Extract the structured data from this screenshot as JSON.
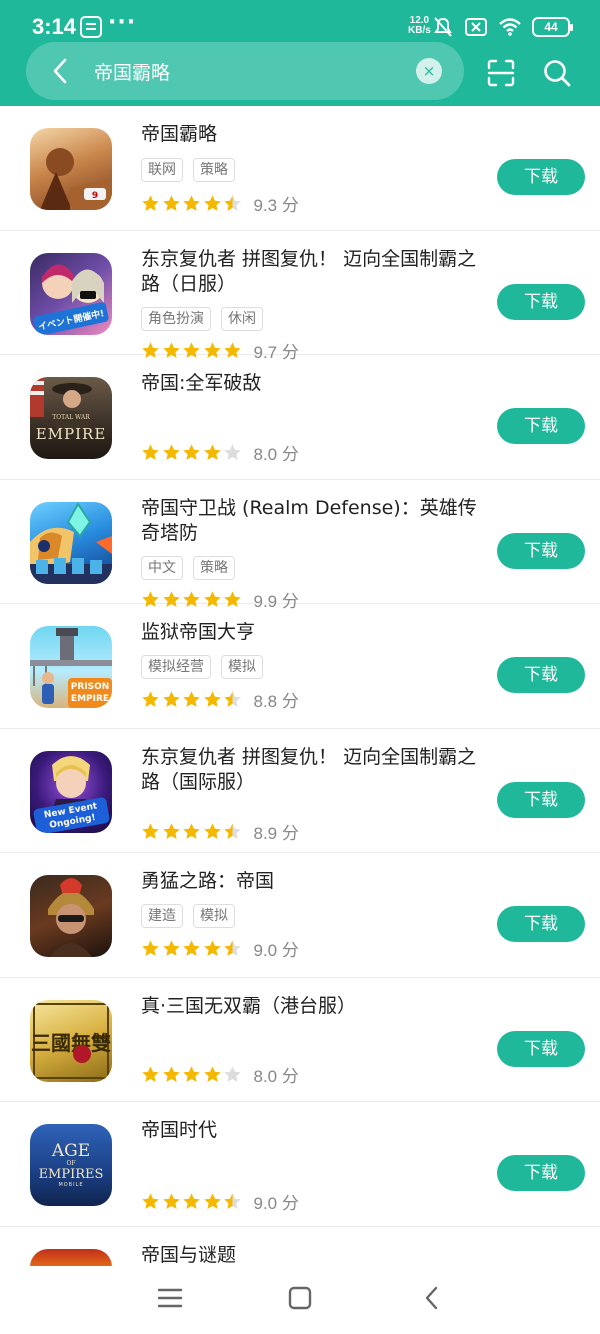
{
  "status_bar": {
    "time": "3:14",
    "dots": "···",
    "speed_value": "12.0",
    "speed_unit": "KB/s",
    "battery": "44"
  },
  "search": {
    "query": "帝国霸略",
    "clear_label": "×"
  },
  "download_label": "下载",
  "score_unit": "分",
  "items": [
    {
      "title": "帝国霸略",
      "tags": [
        "联网",
        "策略"
      ],
      "score": "9.3",
      "stars": 4.5
    },
    {
      "title": "东京复仇者 拼图复仇！ 迈向全国制霸之路（日服）",
      "tags": [
        "角色扮演",
        "休闲"
      ],
      "score": "9.7",
      "stars": 5
    },
    {
      "title": "帝国:全军破敌",
      "tags": [],
      "score": "8.0",
      "stars": 4
    },
    {
      "title": "帝国守卫战 (Realm Defense)：英雄传奇塔防",
      "tags": [
        "中文",
        "策略"
      ],
      "score": "9.9",
      "stars": 5
    },
    {
      "title": "监狱帝国大亨",
      "tags": [
        "模拟经营",
        "模拟"
      ],
      "score": "8.8",
      "stars": 4.5
    },
    {
      "title": "东京复仇者 拼图复仇！ 迈向全国制霸之路（国际服）",
      "tags": [],
      "score": "8.9",
      "stars": 4.5
    },
    {
      "title": "勇猛之路：帝国",
      "tags": [
        "建造",
        "模拟"
      ],
      "score": "9.0",
      "stars": 4.5
    },
    {
      "title": "真·三国无双霸（港台服）",
      "tags": [],
      "score": "8.0",
      "stars": 4
    },
    {
      "title": "帝国时代",
      "tags": [],
      "score": "9.0",
      "stars": 4.5
    },
    {
      "title": "帝国与谜题",
      "tags": [],
      "score": "",
      "stars": 0
    }
  ],
  "icon_texts": {
    "item2": "イベント開催中!",
    "item3_top": "TOTAL WAR",
    "item3_main": "EMPIRE",
    "item5_top": "PRISON",
    "item5_main": "EMPIRE",
    "item6_a": "New Event",
    "item6_b": "Ongoing!",
    "item8": "三國無雙",
    "item9_a": "AGE",
    "item9_b": "OF",
    "item9_c": "EMPIRES",
    "item9_d": "MOBILE"
  },
  "colors": {
    "brand": "#1fb89a",
    "star": "#f5b800",
    "star_empty": "#dddddd"
  }
}
